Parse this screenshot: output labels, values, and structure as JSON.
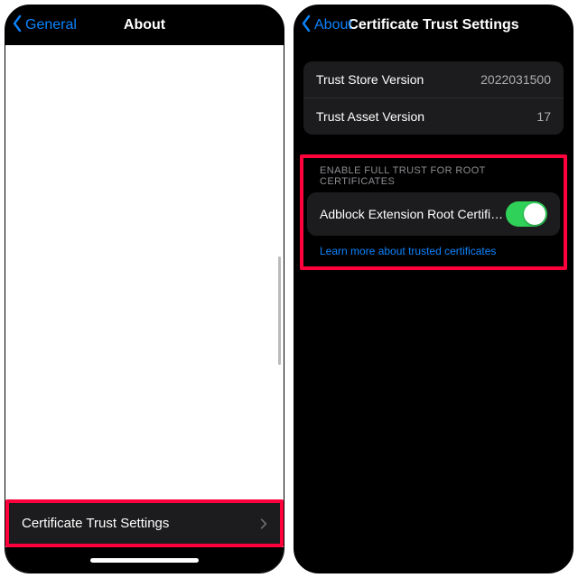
{
  "left": {
    "back_label": "General",
    "title": "About",
    "cert_row_label": "Certificate Trust Settings"
  },
  "right": {
    "back_label": "About",
    "title": "Certificate Trust Settings",
    "rows": {
      "store_label": "Trust Store Version",
      "store_value": "2022031500",
      "asset_label": "Trust Asset Version",
      "asset_value": "17"
    },
    "section_header": "ENABLE FULL TRUST FOR ROOT CERTIFICATES",
    "toggle_label": "Adblock Extension Root Certificat…",
    "toggle_on": true,
    "learn_more": "Learn more about trusted certificates"
  },
  "colors": {
    "accent_blue": "#0a84ff",
    "highlight": "#ff003c",
    "switch_on": "#30d158"
  }
}
